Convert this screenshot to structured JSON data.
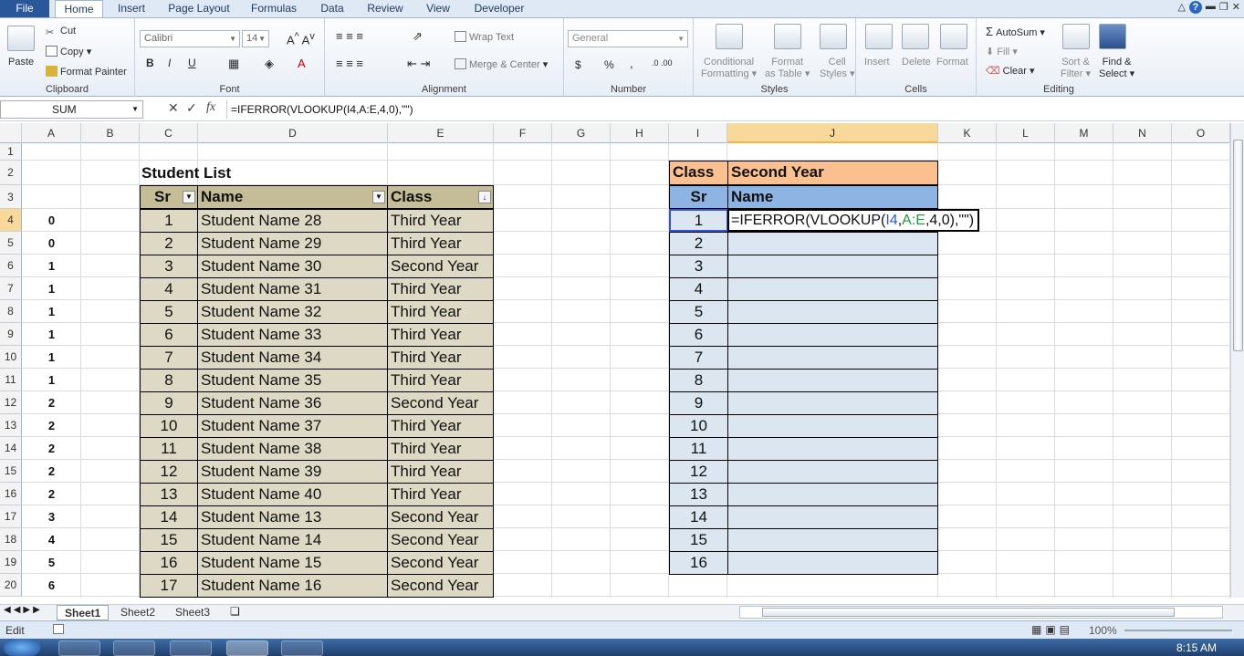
{
  "ribbon": {
    "tabs": [
      "File",
      "Home",
      "Insert",
      "Page Layout",
      "Formulas",
      "Data",
      "Review",
      "View",
      "Developer"
    ],
    "clipboard": {
      "paste": "Paste",
      "cut": "Cut",
      "copy": "Copy",
      "format_painter": "Format Painter",
      "label": "Clipboard"
    },
    "font": {
      "name": "Calibri",
      "size": "14",
      "label": "Font"
    },
    "alignment": {
      "wrap": "Wrap Text",
      "merge": "Merge & Center",
      "label": "Alignment"
    },
    "number": {
      "format": "General",
      "label": "Number",
      "currency": "$",
      "percent": "%",
      "comma": ","
    },
    "styles": {
      "conditional": "Conditional",
      "formatting": "Formatting",
      "format_as": "Format",
      "as_table": "as Table",
      "cell": "Cell",
      "cell_styles": "Styles",
      "label": "Styles"
    },
    "cells": {
      "insert": "Insert",
      "delete": "Delete",
      "format": "Format",
      "label": "Cells"
    },
    "editing": {
      "autosum": "AutoSum",
      "fill": "Fill",
      "clear": "Clear",
      "sort": "Sort &",
      "filter": "Filter",
      "find": "Find &",
      "select": "Select",
      "label": "Editing"
    }
  },
  "formula_bar": {
    "name_box": "SUM",
    "formula": "=IFERROR(VLOOKUP(I4,A:E,4,0),\"\")"
  },
  "columns": [
    "A",
    "B",
    "C",
    "D",
    "E",
    "F",
    "G",
    "H",
    "I",
    "J",
    "K",
    "L",
    "M",
    "N",
    "O"
  ],
  "rows": [
    "1",
    "2",
    "3",
    "4",
    "5",
    "6",
    "7",
    "8",
    "9",
    "10",
    "11",
    "12",
    "13",
    "14",
    "15",
    "16",
    "17",
    "18",
    "19",
    "20"
  ],
  "helper_col_a": [
    "0",
    "0",
    "1",
    "1",
    "1",
    "1",
    "1",
    "1",
    "2",
    "2",
    "2",
    "2",
    "2",
    "3",
    "4",
    "5",
    "6"
  ],
  "student_table": {
    "title": "Student List",
    "headers": [
      "Sr",
      "Name",
      "Class"
    ],
    "rows": [
      [
        "1",
        "Student Name 28",
        "Third Year"
      ],
      [
        "2",
        "Student Name 29",
        "Third Year"
      ],
      [
        "3",
        "Student Name 30",
        "Second Year"
      ],
      [
        "4",
        "Student Name 31",
        "Third Year"
      ],
      [
        "5",
        "Student Name 32",
        "Third Year"
      ],
      [
        "6",
        "Student Name 33",
        "Third Year"
      ],
      [
        "7",
        "Student Name 34",
        "Third Year"
      ],
      [
        "8",
        "Student Name 35",
        "Third Year"
      ],
      [
        "9",
        "Student Name 36",
        "Second Year"
      ],
      [
        "10",
        "Student Name 37",
        "Third Year"
      ],
      [
        "11",
        "Student Name 38",
        "Third Year"
      ],
      [
        "12",
        "Student Name 39",
        "Third Year"
      ],
      [
        "13",
        "Student Name 40",
        "Third Year"
      ],
      [
        "14",
        "Student Name 13",
        "Second Year"
      ],
      [
        "15",
        "Student Name 14",
        "Second Year"
      ],
      [
        "16",
        "Student Name 15",
        "Second Year"
      ],
      [
        "17",
        "Student Name 16",
        "Second Year"
      ]
    ]
  },
  "result_table": {
    "class_label": "Class",
    "class_value": "Second Year",
    "headers": [
      "Sr",
      "Name"
    ],
    "sr": [
      "1",
      "2",
      "3",
      "4",
      "5",
      "6",
      "7",
      "8",
      "9",
      "10",
      "11",
      "12",
      "13",
      "14",
      "15",
      "16"
    ],
    "editing_formula": {
      "prefix": "=IFERROR(VLOOKUP(",
      "ref1": "I4",
      "sep1": ",",
      "ref2": "A:E",
      "rest": ",4,0),\"\")"
    }
  },
  "sheets": [
    "Sheet1",
    "Sheet2",
    "Sheet3"
  ],
  "status": {
    "mode": "Edit",
    "zoom": "100%"
  },
  "taskbar": {
    "time": "8:15 AM"
  }
}
